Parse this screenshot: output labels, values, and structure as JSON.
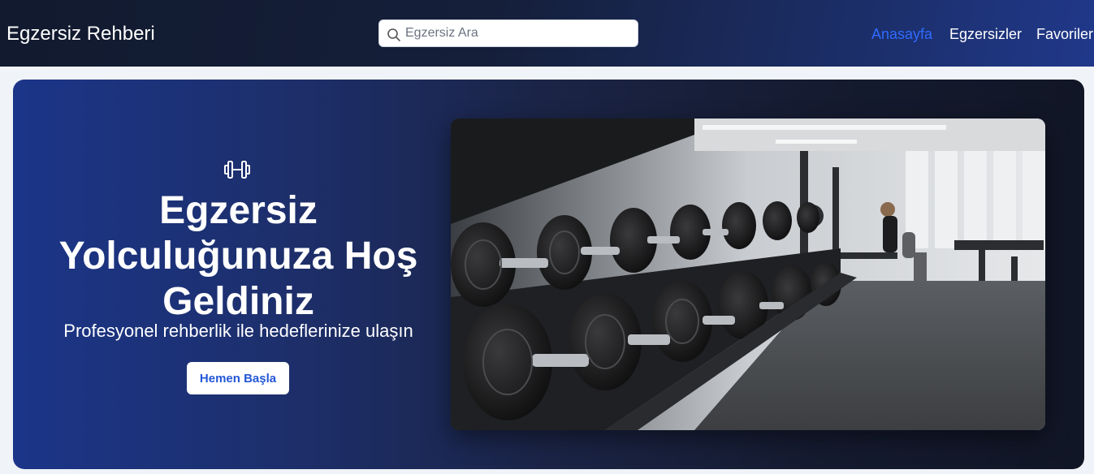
{
  "header": {
    "brand": "Egzersiz Rehberi",
    "search": {
      "placeholder": "Egzersiz Ara",
      "value": ""
    },
    "nav": [
      {
        "label": "Anasayfa",
        "active": true
      },
      {
        "label": "Egzersizler",
        "active": false
      },
      {
        "label": "Favoriler",
        "active": false
      }
    ]
  },
  "hero": {
    "icon": "dumbbell-icon",
    "title": "Egzersiz Yolculuğunuza Hoş Geldiniz",
    "subtitle": "Profesyonel rehberlik ile hedeflerinize ulaşın",
    "cta_label": "Hemen Başla",
    "image_icon": "gym-dumbbell-rack-photo"
  },
  "colors": {
    "nav_active": "#2f6bff",
    "cta_text": "#2357d6",
    "hero_gradient_start": "#1b3588",
    "hero_gradient_end": "#111626"
  }
}
